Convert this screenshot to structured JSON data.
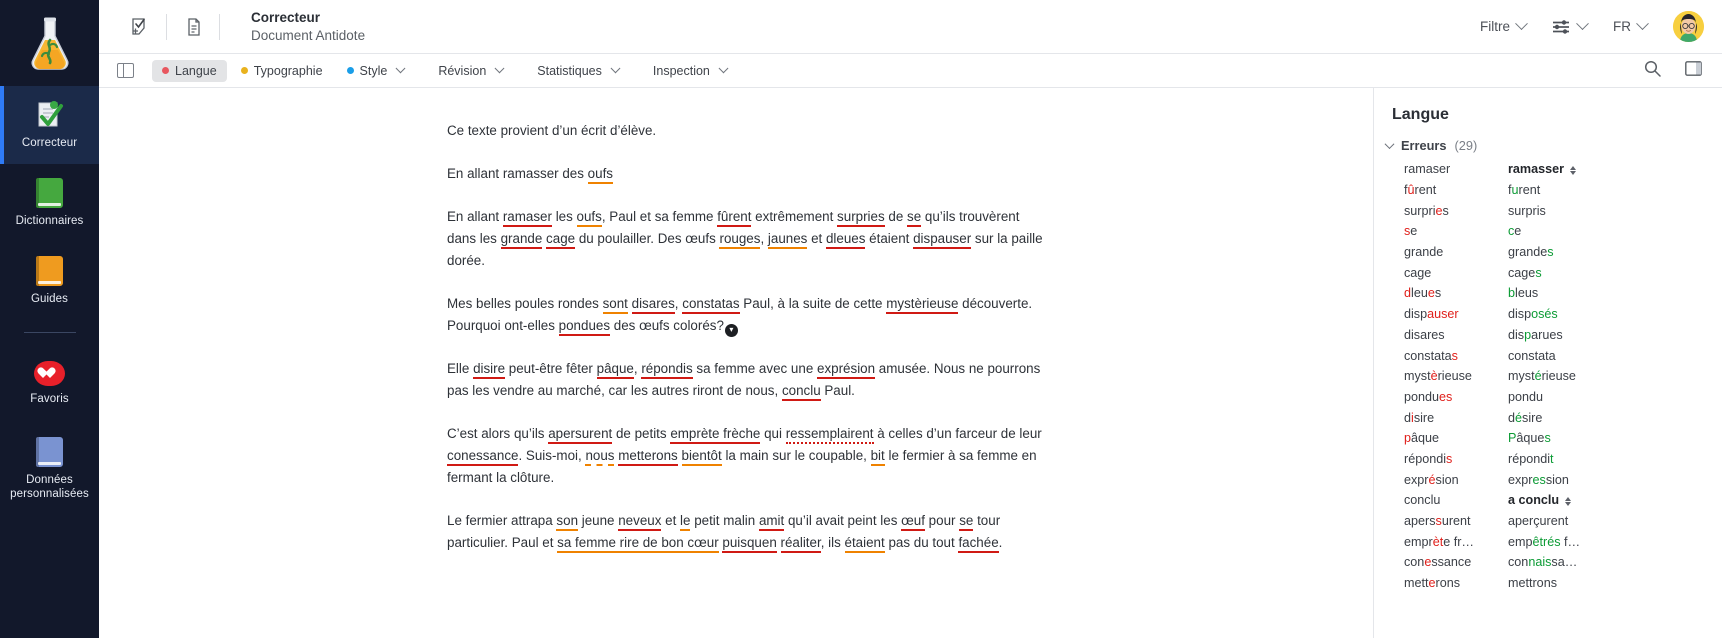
{
  "rail": {
    "logo_icon": "flask-logo",
    "items": [
      {
        "label": "Correcteur",
        "icon": "checklist-icon",
        "active": true
      },
      {
        "label": "Dictionnaires",
        "icon": "green-book-icon",
        "active": false
      },
      {
        "label": "Guides",
        "icon": "orange-book-icon",
        "active": false
      },
      {
        "label": "Favoris",
        "icon": "heart-icon",
        "active": false
      },
      {
        "label": "Données personnalisées",
        "icon": "blue-book-icon",
        "active": false
      }
    ]
  },
  "topbar": {
    "correct_icon": "check-document-icon",
    "document_icon": "document-stack-icon",
    "title": "Correcteur",
    "subtitle": "Document Antidote",
    "filter_label": "Filtre",
    "sliders_icon": "sliders-icon",
    "language_label": "FR",
    "avatar_icon": "user-avatar"
  },
  "tabstrip": {
    "panel_toggle_icon": "panel-toggle-icon",
    "tabs": [
      {
        "label": "Langue",
        "dot": "#e8575f",
        "selected": true,
        "chevron": false
      },
      {
        "label": "Typographie",
        "dot": "#e9b21e",
        "selected": false,
        "chevron": false
      },
      {
        "label": "Style",
        "dot": "#1a9ee8",
        "selected": false,
        "chevron": true
      },
      {
        "label": "Révision",
        "dot": null,
        "selected": false,
        "chevron": true
      },
      {
        "label": "Statistiques",
        "dot": null,
        "selected": false,
        "chevron": true
      },
      {
        "label": "Inspection",
        "dot": null,
        "selected": false,
        "chevron": true
      }
    ],
    "search_icon": "search-icon",
    "right_panel_icon": "right-panel-icon"
  },
  "document": {
    "paragraphs": [
      {
        "id": "p1",
        "runs": [
          {
            "t": "Ce texte provient d’un écrit d’élève.",
            "m": ""
          }
        ]
      },
      {
        "id": "p2",
        "runs": [
          {
            "t": "En allant ramasser des ",
            "m": ""
          },
          {
            "t": "oufs",
            "m": "o"
          }
        ]
      },
      {
        "id": "p3",
        "runs": [
          {
            "t": "En allant ",
            "m": ""
          },
          {
            "t": "ramaser",
            "m": "r"
          },
          {
            "t": " les ",
            "m": ""
          },
          {
            "t": "oufs",
            "m": "o"
          },
          {
            "t": ", Paul et sa femme ",
            "m": ""
          },
          {
            "t": "fûrent",
            "m": "r"
          },
          {
            "t": " extrêmement ",
            "m": ""
          },
          {
            "t": "surpries",
            "m": "r"
          },
          {
            "t": " de ",
            "m": ""
          },
          {
            "t": "se",
            "m": "r"
          },
          {
            "t": " qu’ils trouvèrent dans les ",
            "m": ""
          },
          {
            "t": "grande",
            "m": "r"
          },
          {
            "t": " ",
            "m": ""
          },
          {
            "t": "cage",
            "m": "r"
          },
          {
            "t": " du poulailler. Des œufs ",
            "m": ""
          },
          {
            "t": "rouges",
            "m": "o"
          },
          {
            "t": ", ",
            "m": ""
          },
          {
            "t": "jaunes",
            "m": "o"
          },
          {
            "t": " et ",
            "m": ""
          },
          {
            "t": "dleues",
            "m": "r"
          },
          {
            "t": " étaient ",
            "m": ""
          },
          {
            "t": "dispauser",
            "m": "r"
          },
          {
            "t": " sur la paille dorée.",
            "m": ""
          }
        ]
      },
      {
        "id": "p4",
        "runs": [
          {
            "t": "Mes belles poules rondes ",
            "m": ""
          },
          {
            "t": "sont",
            "m": "o"
          },
          {
            "t": " ",
            "m": ""
          },
          {
            "t": "disares",
            "m": "r"
          },
          {
            "t": ", ",
            "m": ""
          },
          {
            "t": "constatas",
            "m": "r"
          },
          {
            "t": " Paul, à la suite de cette ",
            "m": ""
          },
          {
            "t": "mystèrieuse",
            "m": "r"
          },
          {
            "t": " découverte. Pourquoi ont-elles ",
            "m": ""
          },
          {
            "t": "pondues",
            "m": "r"
          },
          {
            "t": " des œufs colorés?",
            "m": ""
          },
          {
            "t": "▾",
            "m": "badge"
          }
        ]
      },
      {
        "id": "p5",
        "runs": [
          {
            "t": "Elle ",
            "m": ""
          },
          {
            "t": "disire",
            "m": "r"
          },
          {
            "t": " peut-être fêter ",
            "m": ""
          },
          {
            "t": "pâque",
            "m": "r"
          },
          {
            "t": ", ",
            "m": ""
          },
          {
            "t": "répondis",
            "m": "r"
          },
          {
            "t": " sa femme avec une ",
            "m": ""
          },
          {
            "t": "exprésion",
            "m": "r"
          },
          {
            "t": " amusée. Nous ne pourrons pas les vendre au marché, car les autres riront de nous, ",
            "m": ""
          },
          {
            "t": "conclu",
            "m": "r"
          },
          {
            "t": " Paul.",
            "m": ""
          }
        ]
      },
      {
        "id": "p6",
        "runs": [
          {
            "t": "C’est alors qu’ils ",
            "m": ""
          },
          {
            "t": "apersurent",
            "m": "r"
          },
          {
            "t": " de petits ",
            "m": ""
          },
          {
            "t": "emprète frèche",
            "m": "r"
          },
          {
            "t": " qui ",
            "m": ""
          },
          {
            "t": "ressemplairent",
            "m": "rd"
          },
          {
            "t": " à celles d’un farceur de leur ",
            "m": ""
          },
          {
            "t": "conessance",
            "m": "r"
          },
          {
            "t": ". Suis-moi, ",
            "m": ""
          },
          {
            "t": "nous",
            "m": "od"
          },
          {
            "t": " ",
            "m": ""
          },
          {
            "t": "metterons",
            "m": "r"
          },
          {
            "t": " ",
            "m": ""
          },
          {
            "t": "bientôt",
            "m": "o"
          },
          {
            "t": " la main sur le coupable, ",
            "m": ""
          },
          {
            "t": "bit",
            "m": "o"
          },
          {
            "t": " le fermier à sa femme en fermant la clôture.",
            "m": ""
          }
        ]
      },
      {
        "id": "p7",
        "runs": [
          {
            "t": "Le fermier attrapa ",
            "m": ""
          },
          {
            "t": "son",
            "m": "o"
          },
          {
            "t": " jeune ",
            "m": ""
          },
          {
            "t": "neveux",
            "m": "r"
          },
          {
            "t": " et ",
            "m": ""
          },
          {
            "t": "le",
            "m": "o"
          },
          {
            "t": " petit malin ",
            "m": ""
          },
          {
            "t": "amit",
            "m": "r"
          },
          {
            "t": " qu’il avait peint les ",
            "m": ""
          },
          {
            "t": "œuf",
            "m": "r"
          },
          {
            "t": " pour ",
            "m": ""
          },
          {
            "t": "se",
            "m": "r"
          },
          {
            "t": " tour particulier. Paul et ",
            "m": ""
          },
          {
            "t": "sa femme rire de bon cœur",
            "m": "o"
          },
          {
            "t": " ",
            "m": ""
          },
          {
            "t": "puisquen",
            "m": "r"
          },
          {
            "t": " ",
            "m": ""
          },
          {
            "t": "réaliter",
            "m": "r"
          },
          {
            "t": ", ils ",
            "m": ""
          },
          {
            "t": "étaient",
            "m": "o"
          },
          {
            "t": " pas du tout ",
            "m": ""
          },
          {
            "t": "fachée",
            "m": "r"
          },
          {
            "t": ".",
            "m": ""
          }
        ]
      }
    ]
  },
  "right_panel": {
    "title": "Langue",
    "group_label": "Erreurs",
    "group_count": "(29)",
    "errors": [
      {
        "from": [
          {
            "t": "ramaser",
            "s": "n"
          }
        ],
        "to": [
          {
            "t": "ramasser",
            "s": "n"
          }
        ],
        "to_bold": true,
        "stepper": true
      },
      {
        "from": [
          {
            "t": "f",
            "s": "n"
          },
          {
            "t": "û",
            "s": "del"
          },
          {
            "t": "rent",
            "s": "n"
          }
        ],
        "to": [
          {
            "t": "f",
            "s": "n"
          },
          {
            "t": "u",
            "s": "add"
          },
          {
            "t": "rent",
            "s": "n"
          }
        ],
        "to_bold": false,
        "stepper": false
      },
      {
        "from": [
          {
            "t": "surpri",
            "s": "n"
          },
          {
            "t": "e",
            "s": "del"
          },
          {
            "t": "s",
            "s": "n"
          }
        ],
        "to": [
          {
            "t": "surpris",
            "s": "n"
          }
        ],
        "to_bold": false,
        "stepper": false
      },
      {
        "from": [
          {
            "t": "s",
            "s": "del"
          },
          {
            "t": "e",
            "s": "n"
          }
        ],
        "to": [
          {
            "t": "c",
            "s": "add"
          },
          {
            "t": "e",
            "s": "n"
          }
        ],
        "to_bold": false,
        "stepper": false
      },
      {
        "from": [
          {
            "t": "grande",
            "s": "n"
          }
        ],
        "to": [
          {
            "t": "grande",
            "s": "n"
          },
          {
            "t": "s",
            "s": "add"
          }
        ],
        "to_bold": false,
        "stepper": false
      },
      {
        "from": [
          {
            "t": "cage",
            "s": "n"
          }
        ],
        "to": [
          {
            "t": "cage",
            "s": "n"
          },
          {
            "t": "s",
            "s": "add"
          }
        ],
        "to_bold": false,
        "stepper": false
      },
      {
        "from": [
          {
            "t": "d",
            "s": "del"
          },
          {
            "t": "leu",
            "s": "n"
          },
          {
            "t": "e",
            "s": "del"
          },
          {
            "t": "s",
            "s": "n"
          }
        ],
        "to": [
          {
            "t": "b",
            "s": "add"
          },
          {
            "t": "leus",
            "s": "n"
          }
        ],
        "to_bold": false,
        "stepper": false
      },
      {
        "from": [
          {
            "t": "disp",
            "s": "n"
          },
          {
            "t": "auser",
            "s": "del"
          }
        ],
        "to": [
          {
            "t": "disp",
            "s": "n"
          },
          {
            "t": "osés",
            "s": "add"
          }
        ],
        "to_bold": false,
        "stepper": false
      },
      {
        "from": [
          {
            "t": "disares",
            "s": "n"
          }
        ],
        "to": [
          {
            "t": "dis",
            "s": "n"
          },
          {
            "t": "p",
            "s": "add"
          },
          {
            "t": "arues",
            "s": "n"
          }
        ],
        "to_bold": false,
        "stepper": false
      },
      {
        "from": [
          {
            "t": "constata",
            "s": "n"
          },
          {
            "t": "s",
            "s": "del"
          }
        ],
        "to": [
          {
            "t": "constata",
            "s": "n"
          }
        ],
        "to_bold": false,
        "stepper": false
      },
      {
        "from": [
          {
            "t": "myst",
            "s": "n"
          },
          {
            "t": "è",
            "s": "del"
          },
          {
            "t": "rieuse",
            "s": "n"
          }
        ],
        "to": [
          {
            "t": "myst",
            "s": "n"
          },
          {
            "t": "é",
            "s": "add"
          },
          {
            "t": "rieuse",
            "s": "n"
          }
        ],
        "to_bold": false,
        "stepper": false
      },
      {
        "from": [
          {
            "t": "pondu",
            "s": "n"
          },
          {
            "t": "es",
            "s": "del"
          }
        ],
        "to": [
          {
            "t": "pondu",
            "s": "n"
          }
        ],
        "to_bold": false,
        "stepper": false
      },
      {
        "from": [
          {
            "t": "d",
            "s": "n"
          },
          {
            "t": "i",
            "s": "del"
          },
          {
            "t": "sire",
            "s": "n"
          }
        ],
        "to": [
          {
            "t": "d",
            "s": "n"
          },
          {
            "t": "é",
            "s": "add"
          },
          {
            "t": "sire",
            "s": "n"
          }
        ],
        "to_bold": false,
        "stepper": false
      },
      {
        "from": [
          {
            "t": "p",
            "s": "del"
          },
          {
            "t": "âque",
            "s": "n"
          }
        ],
        "to": [
          {
            "t": "P",
            "s": "add"
          },
          {
            "t": "âque",
            "s": "n"
          },
          {
            "t": "s",
            "s": "add"
          }
        ],
        "to_bold": false,
        "stepper": false
      },
      {
        "from": [
          {
            "t": "répondi",
            "s": "n"
          },
          {
            "t": "s",
            "s": "del"
          }
        ],
        "to": [
          {
            "t": "répondi",
            "s": "n"
          },
          {
            "t": "t",
            "s": "add"
          }
        ],
        "to_bold": false,
        "stepper": false
      },
      {
        "from": [
          {
            "t": "expr",
            "s": "n"
          },
          {
            "t": "é",
            "s": "del"
          },
          {
            "t": "sion",
            "s": "n"
          }
        ],
        "to": [
          {
            "t": "expr",
            "s": "n"
          },
          {
            "t": "es",
            "s": "add"
          },
          {
            "t": "sion",
            "s": "n"
          }
        ],
        "to_bold": false,
        "stepper": false
      },
      {
        "from": [
          {
            "t": "conclu",
            "s": "n"
          }
        ],
        "to": [
          {
            "t": "a conclu",
            "s": "n"
          }
        ],
        "to_bold": true,
        "stepper": true
      },
      {
        "from": [
          {
            "t": "apers",
            "s": "n"
          },
          {
            "t": "s",
            "s": "del"
          },
          {
            "t": "urent",
            "s": "n"
          }
        ],
        "to": [
          {
            "t": "aperçurent",
            "s": "n"
          }
        ],
        "to_bold": false,
        "stepper": false
      },
      {
        "from": [
          {
            "t": "empr",
            "s": "n"
          },
          {
            "t": "èt",
            "s": "del"
          },
          {
            "t": "e fr…",
            "s": "n"
          }
        ],
        "to": [
          {
            "t": "emp",
            "s": "n"
          },
          {
            "t": "êtrés",
            "s": "add"
          },
          {
            "t": " f…",
            "s": "n"
          }
        ],
        "to_bold": false,
        "stepper": false
      },
      {
        "from": [
          {
            "t": "con",
            "s": "n"
          },
          {
            "t": "e",
            "s": "del"
          },
          {
            "t": "ssance",
            "s": "n"
          }
        ],
        "to": [
          {
            "t": "con",
            "s": "n"
          },
          {
            "t": "nais",
            "s": "add"
          },
          {
            "t": "sa…",
            "s": "n"
          }
        ],
        "to_bold": false,
        "stepper": false
      },
      {
        "from": [
          {
            "t": "mett",
            "s": "n"
          },
          {
            "t": "e",
            "s": "del"
          },
          {
            "t": "rons",
            "s": "n"
          }
        ],
        "to": [
          {
            "t": "mettrons",
            "s": "n"
          }
        ],
        "to_bold": false,
        "stepper": false
      }
    ]
  },
  "colors": {
    "rail_bg": "#12182b",
    "rail_active": "#1b2a49",
    "accent_blue": "#2f7bf6",
    "error_red": "#d01a14",
    "warn_orange": "#ef8200",
    "del_red": "#e01f1a",
    "add_green": "#0c9b35"
  }
}
